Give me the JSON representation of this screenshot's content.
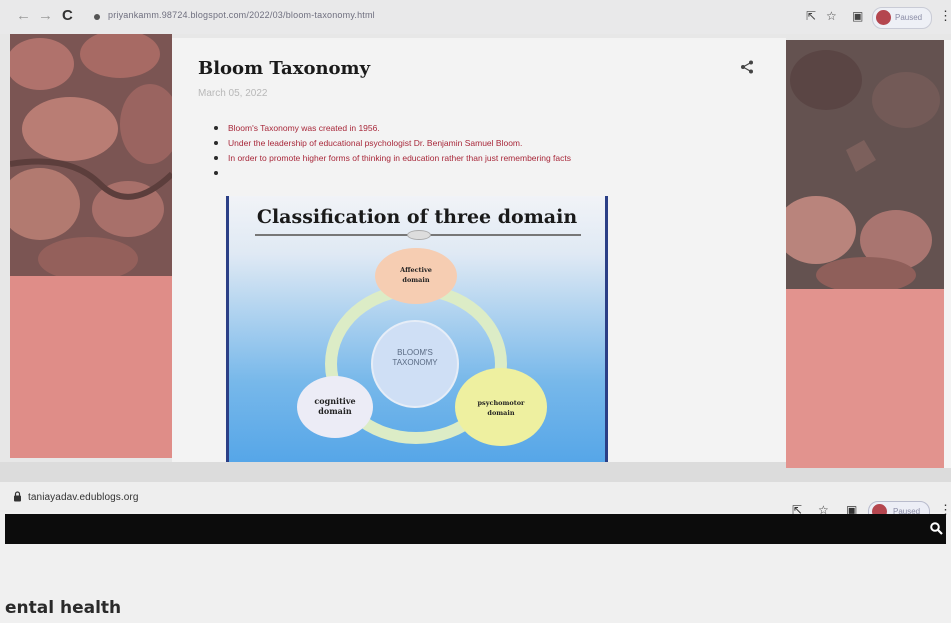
{
  "top_browser": {
    "url": "priyankamm.98724.blogspot.com/2022/03/bloom-taxonomy.html",
    "profile_label": "Paused"
  },
  "post": {
    "title": "Bloom Taxonomy",
    "date": "March 05, 2022",
    "bullets": [
      "Bloom's Taxonomy was created in 1956.",
      "Under the leadership of educational psychologist Dr. Benjamin Samuel Bloom.",
      "In order to promote higher forms of thinking in education rather than just remembering facts",
      ""
    ]
  },
  "slide": {
    "title": "Classification of three domain",
    "center_lines": [
      "BLOOM'S",
      "TAXONOMY"
    ],
    "affective_lines": [
      "Affective",
      "domain"
    ],
    "cognitive_lines": [
      "cognitive",
      "domain"
    ],
    "psychomotor_lines": [
      "psychomotor",
      "domain"
    ]
  },
  "bottom_browser": {
    "url": "taniayadav.edublogs.org",
    "profile_label": "Paused",
    "heading": "ental health"
  }
}
